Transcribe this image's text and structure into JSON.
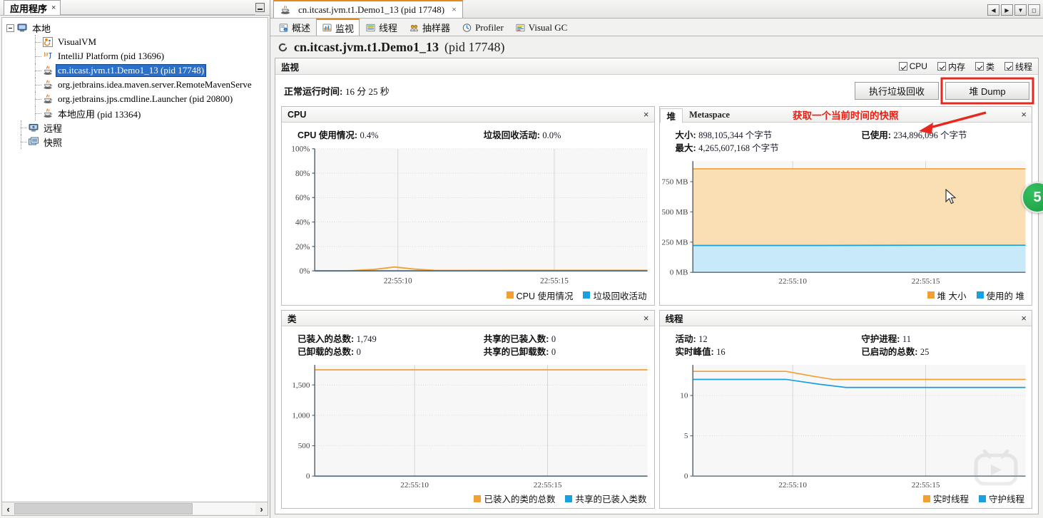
{
  "left_panel": {
    "tab_label": "应用程序",
    "tab_close": "×",
    "tree": [
      {
        "label": "本地",
        "level": 0,
        "icon": "computer-icon",
        "expanded": true,
        "selected": false
      },
      {
        "label": "VisualVM",
        "level": 2,
        "icon": "visualvm-icon",
        "selected": false
      },
      {
        "label": "IntelliJ Platform (pid 13696)",
        "level": 2,
        "icon": "intellij-icon",
        "selected": false
      },
      {
        "label": "cn.itcast.jvm.t1.Demo1_13 (pid 17748)",
        "level": 2,
        "icon": "java-icon",
        "selected": true
      },
      {
        "label": "org.jetbrains.idea.maven.server.RemoteMavenServe",
        "level": 2,
        "icon": "java-icon",
        "selected": false
      },
      {
        "label": "org.jetbrains.jps.cmdline.Launcher (pid 20800)",
        "level": 2,
        "icon": "java-icon",
        "selected": false
      },
      {
        "label": "本地应用 (pid 13364)",
        "level": 2,
        "icon": "java-icon",
        "selected": false
      },
      {
        "label": "远程",
        "level": 1,
        "icon": "remote-icon",
        "selected": false
      },
      {
        "label": "快照",
        "level": 1,
        "icon": "snapshot-icon",
        "selected": false
      }
    ],
    "scroll_left_arrow": "‹",
    "scroll_right_arrow": "›"
  },
  "window": {
    "doc_tab_label": "cn.itcast.jvm.t1.Demo1_13 (pid 17748)",
    "doc_tab_close": "×",
    "controls": [
      {
        "name": "prev-tab-button",
        "glyph": "◀"
      },
      {
        "name": "next-tab-button",
        "glyph": "▶"
      },
      {
        "name": "tab-list-button",
        "glyph": "▼"
      },
      {
        "name": "maximize-button",
        "glyph": "◻"
      }
    ]
  },
  "tabs": [
    {
      "label": "概述",
      "icon": "overview-icon",
      "active": false
    },
    {
      "label": "监视",
      "icon": "monitor-icon",
      "active": true
    },
    {
      "label": "线程",
      "icon": "threads-icon",
      "active": false
    },
    {
      "label": "抽样器",
      "icon": "sampler-icon",
      "active": false
    },
    {
      "label": "Profiler",
      "icon": "profiler-icon",
      "active": false
    },
    {
      "label": "Visual GC",
      "icon": "visualgc-icon",
      "active": false
    }
  ],
  "process": {
    "title": "cn.itcast.jvm.t1.Demo1_13",
    "pid_text": "(pid 17748)"
  },
  "monitor": {
    "header": "监视",
    "checkboxes": [
      {
        "label": "CPU",
        "checked": true
      },
      {
        "label": "内存",
        "checked": true
      },
      {
        "label": "类",
        "checked": true
      },
      {
        "label": "线程",
        "checked": true
      }
    ],
    "uptime_label": "正常运行时间:",
    "uptime_value": "16 分 25 秒",
    "gc_button": "执行垃圾回收",
    "heapdump_button": "堆 Dump",
    "annotation": "获取一个当前时间的快照",
    "annotation_color": "#f01b10",
    "highlight_color": "#e8281e"
  },
  "colors": {
    "orange": "#f2a033",
    "blue": "#18a0e0",
    "orange_fill": "#fadfb5",
    "blue_fill": "#c7e9f9"
  },
  "badge": {
    "text": "5"
  },
  "chart_data": [
    {
      "id": "cpu",
      "type": "line",
      "panel_title": "CPU",
      "close_glyph": "×",
      "stats": [
        {
          "label": "CPU 使用情况:",
          "value": "0.4%"
        },
        {
          "label": "垃圾回收活动:",
          "value": "0.0%"
        }
      ],
      "title": "CPU",
      "xlabel": "",
      "ylabel": "",
      "ylim": [
        0,
        100
      ],
      "yticks": [
        0,
        20,
        40,
        60,
        80,
        100
      ],
      "ytick_labels": [
        "0%",
        "20%",
        "40%",
        "60%",
        "80%",
        "100%"
      ],
      "xticks": [
        0.25,
        0.72
      ],
      "xtick_labels": [
        "22:55:10",
        "22:55:15"
      ],
      "grid": true,
      "legend_position": "bottom-right",
      "series": [
        {
          "name": "CPU 使用情况",
          "color": "#f2a033",
          "x": [
            0.0,
            0.1,
            0.18,
            0.24,
            0.3,
            0.36,
            0.45,
            0.6,
            0.8,
            1.0
          ],
          "values": [
            0,
            0,
            1.2,
            3.2,
            1.4,
            0.4,
            0.3,
            0.4,
            0.4,
            0.4
          ]
        },
        {
          "name": "垃圾回收活动",
          "color": "#18a0e0",
          "x": [
            0.0,
            0.25,
            0.5,
            0.75,
            1.0
          ],
          "values": [
            0,
            0,
            0,
            0,
            0
          ]
        }
      ]
    },
    {
      "id": "heap",
      "type": "area",
      "panel_title": "堆",
      "secondary_tab": "Metaspace",
      "close_glyph": "×",
      "stats": [
        {
          "label": "大小:",
          "value": "898,105,344 个字节"
        },
        {
          "label": "已使用:",
          "value": "234,896,096 个字节"
        },
        {
          "label": "最大:",
          "value": "4,265,607,168 个字节"
        }
      ],
      "title": "堆",
      "ylim": [
        0,
        920
      ],
      "yticks": [
        0,
        250,
        500,
        750
      ],
      "ytick_labels": [
        "0 MB",
        "250 MB",
        "500 MB",
        "750 MB"
      ],
      "xticks": [
        0.3,
        0.7
      ],
      "xtick_labels": [
        "22:55:10",
        "22:55:15"
      ],
      "grid": true,
      "legend_position": "bottom-right",
      "series": [
        {
          "name": "堆 大小",
          "color": "#f2a033",
          "fill": "#fadfb5",
          "x": [
            0.0,
            0.25,
            0.5,
            0.75,
            1.0
          ],
          "values": [
            856,
            856,
            856,
            856,
            856
          ]
        },
        {
          "name": "使用的 堆",
          "color": "#18a0e0",
          "fill": "#c7e9f9",
          "x": [
            0.0,
            0.25,
            0.5,
            0.75,
            1.0
          ],
          "values": [
            222,
            222,
            223,
            224,
            224
          ]
        }
      ]
    },
    {
      "id": "classes",
      "type": "line",
      "panel_title": "类",
      "close_glyph": "×",
      "stats": [
        {
          "label": "已装入的总数:",
          "value": "1,749"
        },
        {
          "label": "共享的已装入数:",
          "value": "0"
        },
        {
          "label": "已卸载的总数:",
          "value": "0"
        },
        {
          "label": "共享的已卸载数:",
          "value": "0"
        }
      ],
      "title": "类",
      "ylim": [
        0,
        1830
      ],
      "yticks": [
        0,
        500,
        1000,
        1500
      ],
      "ytick_labels": [
        "0",
        "500",
        "1,000",
        "1,500"
      ],
      "xticks": [
        0.3,
        0.7
      ],
      "xtick_labels": [
        "22:55:10",
        "22:55:15"
      ],
      "grid": true,
      "legend_position": "bottom-right",
      "series": [
        {
          "name": "已装入的类的总数",
          "color": "#f2a033",
          "x": [
            0.0,
            0.25,
            0.5,
            0.75,
            1.0
          ],
          "values": [
            1749,
            1749,
            1749,
            1749,
            1749
          ]
        },
        {
          "name": "共享的已装入类数",
          "color": "#18a0e0",
          "x": [
            0.0,
            0.25,
            0.5,
            0.75,
            1.0
          ],
          "values": [
            0,
            0,
            0,
            0,
            0
          ]
        }
      ]
    },
    {
      "id": "threads",
      "type": "line",
      "panel_title": "线程",
      "close_glyph": "×",
      "stats": [
        {
          "label": "活动:",
          "value": "12"
        },
        {
          "label": "守护进程:",
          "value": "11"
        },
        {
          "label": "实时峰值:",
          "value": "16"
        },
        {
          "label": "已启动的总数:",
          "value": "25"
        }
      ],
      "title": "线程",
      "ylim": [
        0,
        13.8
      ],
      "yticks": [
        0,
        5,
        10
      ],
      "ytick_labels": [
        "0",
        "5",
        "10"
      ],
      "xticks": [
        0.3,
        0.7
      ],
      "xtick_labels": [
        "22:55:10",
        "22:55:15"
      ],
      "grid": true,
      "legend_position": "bottom-right",
      "series": [
        {
          "name": "实时线程",
          "color": "#f2a033",
          "x": [
            0.0,
            0.28,
            0.36,
            0.42,
            1.0
          ],
          "values": [
            13,
            13,
            12.4,
            12,
            12
          ]
        },
        {
          "name": "守护线程",
          "color": "#18a0e0",
          "x": [
            0.0,
            0.28,
            0.38,
            0.46,
            1.0
          ],
          "values": [
            12,
            12,
            11.4,
            11,
            11
          ]
        }
      ]
    }
  ]
}
